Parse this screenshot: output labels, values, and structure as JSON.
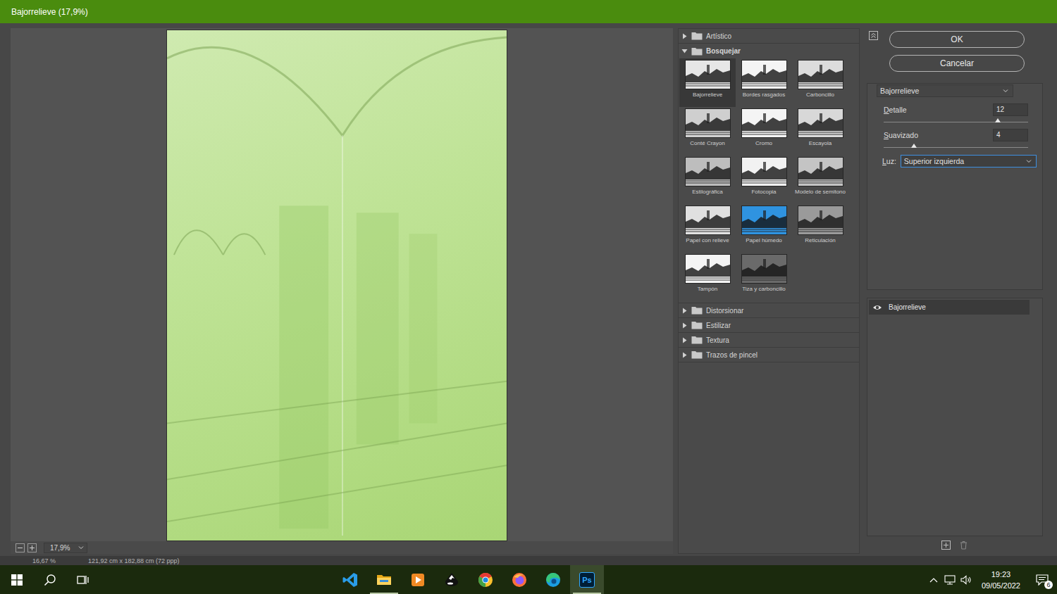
{
  "window": {
    "title": "Bajorrelieve (17,9%)"
  },
  "preview": {
    "zoom": "17,9%"
  },
  "gallery": {
    "folders": [
      {
        "label": "Artístico",
        "expanded": false,
        "filters": []
      },
      {
        "label": "Bosquejar",
        "expanded": true,
        "filters": [
          {
            "label": "Bajorrelieve",
            "selected": true,
            "color": "#e6e6e6"
          },
          {
            "label": "Bordes rasgados",
            "selected": false,
            "color": "#f4f4f4"
          },
          {
            "label": "Carboncillo",
            "selected": false,
            "color": "#dcdcdc"
          },
          {
            "label": "Conté Crayon",
            "selected": false,
            "color": "#cfcfcf"
          },
          {
            "label": "Cromo",
            "selected": false,
            "color": "#f4f4f4"
          },
          {
            "label": "Escayola",
            "selected": false,
            "color": "#d8d8d8"
          },
          {
            "label": "Estilográfica",
            "selected": false,
            "color": "#bdbdbd"
          },
          {
            "label": "Fotocopia",
            "selected": false,
            "color": "#f2f2f2"
          },
          {
            "label": "Modelo de semitono",
            "selected": false,
            "color": "#c4c4c4"
          },
          {
            "label": "Papel con relieve",
            "selected": false,
            "color": "#e0e0e0"
          },
          {
            "label": "Papel húmedo",
            "selected": false,
            "color": "#2f93e0"
          },
          {
            "label": "Reticulación",
            "selected": false,
            "color": "#9a9a9a"
          },
          {
            "label": "Tampón",
            "selected": false,
            "color": "#f4f4f4"
          },
          {
            "label": "Tiza y carboncillo",
            "selected": false,
            "color": "#6a6a6a"
          }
        ]
      },
      {
        "label": "Distorsionar",
        "expanded": false,
        "filters": []
      },
      {
        "label": "Estilizar",
        "expanded": false,
        "filters": []
      },
      {
        "label": "Textura",
        "expanded": false,
        "filters": []
      },
      {
        "label": "Trazos de pincel",
        "expanded": false,
        "filters": []
      }
    ]
  },
  "buttons": [
    {
      "label": "OK"
    },
    {
      "label": "Cancelar"
    }
  ],
  "settings": {
    "filter": "Bajorrelieve",
    "sliders": [
      {
        "label": "Detalle",
        "value": "12",
        "level": 0.79
      },
      {
        "label": "Suavizado",
        "value": "4",
        "level": 0.21
      }
    ],
    "light": {
      "label": "Luz:",
      "value": "Superior izquierda"
    }
  },
  "effect_layers": [
    {
      "label": "Bajorrelieve",
      "visible": true,
      "selected": true
    }
  ],
  "background_status": {
    "zoom": "16,67 %",
    "size": "121,92 cm x 182,88 cm (72 ppp)"
  },
  "taskbar": {
    "apps": [
      {
        "kind": "vscode",
        "running": false,
        "active": false
      },
      {
        "kind": "explorer",
        "running": true,
        "active": false
      },
      {
        "kind": "media",
        "running": false,
        "active": false
      },
      {
        "kind": "inkscape",
        "running": false,
        "active": false
      },
      {
        "kind": "chrome",
        "running": false,
        "active": false
      },
      {
        "kind": "firefox",
        "running": false,
        "active": false
      },
      {
        "kind": "edge",
        "running": false,
        "active": false
      },
      {
        "kind": "photoshop",
        "label": "Ps",
        "running": true,
        "active": true
      }
    ],
    "tray": {
      "time": "19:23",
      "date": "09/05/2022",
      "notifications": "6"
    }
  }
}
